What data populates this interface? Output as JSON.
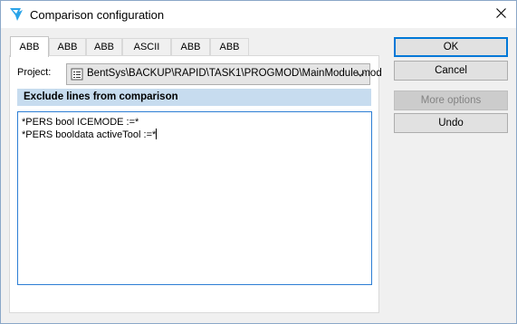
{
  "window": {
    "title": "Comparison configuration",
    "close_icon": "close-icon",
    "app_icon": "app-icon"
  },
  "tabs": [
    {
      "label": "ABB",
      "active": true
    },
    {
      "label": "ABB",
      "active": false
    },
    {
      "label": "ABB",
      "active": false
    },
    {
      "label": "ASCII",
      "active": false
    },
    {
      "label": "ABB",
      "active": false
    },
    {
      "label": "ABB",
      "active": false
    }
  ],
  "project": {
    "label": "Project:",
    "value": "BentSys\\BACKUP\\RAPID\\TASK1\\PROGMOD\\MainModule.mod",
    "icon": "module-file-icon"
  },
  "exclude": {
    "heading": "Exclude lines from comparison",
    "line1": "*PERS bool ICEMODE :=*",
    "line2": "*PERS booldata activeTool :=*"
  },
  "buttons": {
    "ok": "OK",
    "cancel": "Cancel",
    "more_options": "More options",
    "undo": "Undo"
  },
  "colors": {
    "accent": "#0078d7",
    "section_header": "#c7dcef"
  }
}
